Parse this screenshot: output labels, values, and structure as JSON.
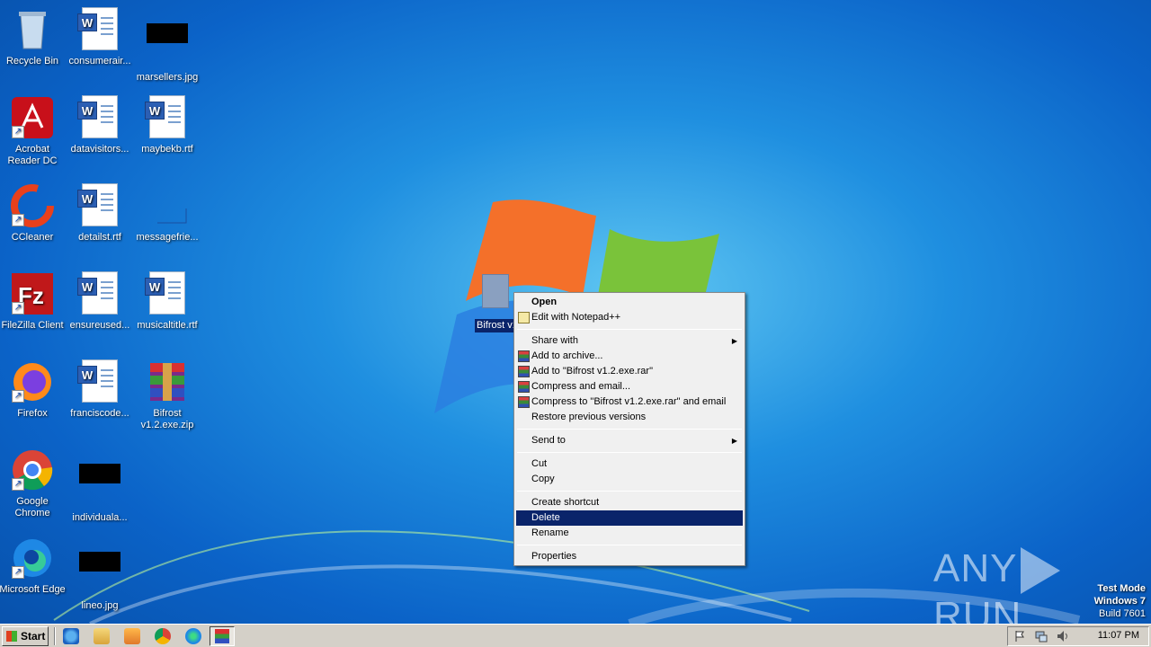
{
  "desktop": {
    "icons": [
      {
        "label": "Recycle Bin"
      },
      {
        "label": "consumerair..."
      },
      {
        "label": "marsellers.jpg"
      },
      {
        "label": "Acrobat Reader DC"
      },
      {
        "label": "datavisitors..."
      },
      {
        "label": "maybekb.rtf"
      },
      {
        "label": "CCleaner"
      },
      {
        "label": "detailst.rtf"
      },
      {
        "label": "messagefrie..."
      },
      {
        "label": "FileZilla Client"
      },
      {
        "label": "ensureused..."
      },
      {
        "label": "musicaltitle.rtf"
      },
      {
        "label": "Firefox"
      },
      {
        "label": "franciscode..."
      },
      {
        "label": "Bifrost v1.2.exe.zip"
      },
      {
        "label": "Google Chrome"
      },
      {
        "label": "individuala..."
      },
      {
        "label": "Microsoft Edge"
      },
      {
        "label": "lineo.jpg"
      }
    ],
    "selected_file": {
      "label": "Bifrost v1.2.exe"
    }
  },
  "context_menu": {
    "items": [
      {
        "label": "Open",
        "icon": ""
      },
      {
        "label": "Edit with Notepad++",
        "icon": "notepadpp-icon"
      },
      {
        "label": "Share with",
        "icon": "",
        "submenu": true
      },
      {
        "label": "Add to archive...",
        "icon": "winrar-icon"
      },
      {
        "label": "Add to \"Bifrost v1.2.exe.rar\"",
        "icon": "winrar-icon"
      },
      {
        "label": "Compress and email...",
        "icon": "winrar-icon"
      },
      {
        "label": "Compress to \"Bifrost v1.2.exe.rar\" and email",
        "icon": "winrar-icon"
      },
      {
        "label": "Restore previous versions",
        "icon": ""
      },
      {
        "label": "Send to",
        "icon": "",
        "submenu": true
      },
      {
        "label": "Cut",
        "icon": ""
      },
      {
        "label": "Copy",
        "icon": ""
      },
      {
        "label": "Create shortcut",
        "icon": ""
      },
      {
        "label": "Delete",
        "icon": "",
        "highlighted": true
      },
      {
        "label": "Rename",
        "icon": ""
      },
      {
        "label": "Properties",
        "icon": ""
      }
    ]
  },
  "watermark": {
    "left": "ANY",
    "right": "RUN"
  },
  "system_info": {
    "line1": "Test Mode",
    "line2": "Windows 7",
    "line3": "Build 7601"
  },
  "taskbar": {
    "start_label": "Start",
    "pinned": [
      "internet-explorer-icon",
      "file-explorer-icon",
      "media-player-icon",
      "chrome-icon",
      "edge-icon",
      "winrar-icon"
    ],
    "clock": "11:07 PM"
  },
  "colors": {
    "menu_highlight": "#0a246a",
    "taskbar": "#d4d0c8"
  }
}
